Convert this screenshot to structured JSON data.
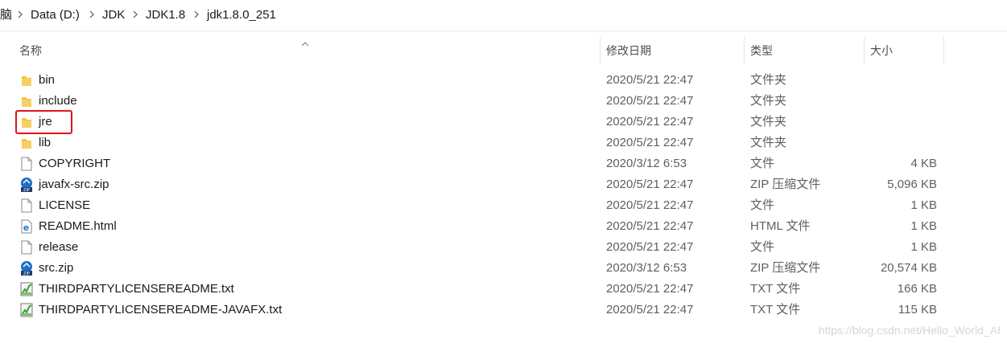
{
  "breadcrumb": {
    "items": [
      "脑",
      "Data (D:)",
      "JDK",
      "JDK1.8",
      "jdk1.8.0_251"
    ]
  },
  "columns": {
    "name": "名称",
    "modified": "修改日期",
    "type": "类型",
    "size": "大小"
  },
  "files": [
    {
      "name": "bin",
      "date": "2020/5/21 22:47",
      "type": "文件夹",
      "size": "",
      "icon": "folder-icon"
    },
    {
      "name": "include",
      "date": "2020/5/21 22:47",
      "type": "文件夹",
      "size": "",
      "icon": "folder-icon"
    },
    {
      "name": "jre",
      "date": "2020/5/21 22:47",
      "type": "文件夹",
      "size": "",
      "icon": "folder-icon"
    },
    {
      "name": "lib",
      "date": "2020/5/21 22:47",
      "type": "文件夹",
      "size": "",
      "icon": "folder-icon"
    },
    {
      "name": "COPYRIGHT",
      "date": "2020/3/12 6:53",
      "type": "文件",
      "size": "4 KB",
      "icon": "file-icon"
    },
    {
      "name": "javafx-src.zip",
      "date": "2020/5/21 22:47",
      "type": "ZIP 压缩文件",
      "size": "5,096 KB",
      "icon": "zip-icon"
    },
    {
      "name": "LICENSE",
      "date": "2020/5/21 22:47",
      "type": "文件",
      "size": "1 KB",
      "icon": "file-icon"
    },
    {
      "name": "README.html",
      "date": "2020/5/21 22:47",
      "type": "HTML 文件",
      "size": "1 KB",
      "icon": "html-icon"
    },
    {
      "name": "release",
      "date": "2020/5/21 22:47",
      "type": "文件",
      "size": "1 KB",
      "icon": "file-icon"
    },
    {
      "name": "src.zip",
      "date": "2020/3/12 6:53",
      "type": "ZIP 压缩文件",
      "size": "20,574 KB",
      "icon": "zip-icon"
    },
    {
      "name": "THIRDPARTYLICENSEREADME.txt",
      "date": "2020/5/21 22:47",
      "type": "TXT 文件",
      "size": "166 KB",
      "icon": "txt-icon"
    },
    {
      "name": "THIRDPARTYLICENSEREADME-JAVAFX.txt",
      "date": "2020/5/21 22:47",
      "type": "TXT 文件",
      "size": "115 KB",
      "icon": "txt-icon"
    }
  ],
  "watermark": "https://blog.csdn.net/Hello_World_AI",
  "colors": {
    "highlight": "#e0141c",
    "folder": "#f5c342",
    "zip_icon": "#1f6fc5"
  }
}
